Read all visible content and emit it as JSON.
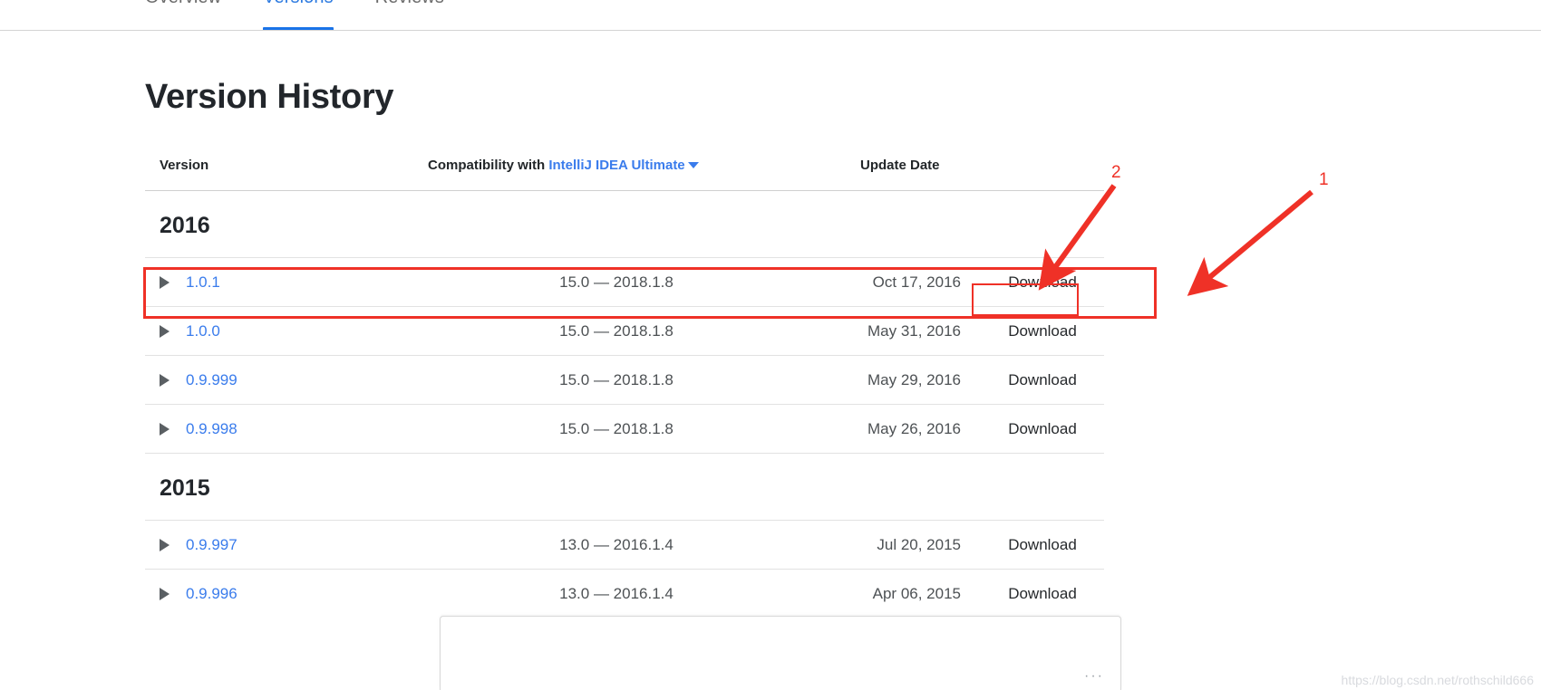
{
  "tabs": [
    {
      "label": "Overview",
      "active": false
    },
    {
      "label": "Versions",
      "active": true
    },
    {
      "label": "Reviews",
      "active": false
    }
  ],
  "page": {
    "title": "Version History"
  },
  "table": {
    "headers": {
      "version": "Version",
      "compatibility_prefix": "Compatibility with",
      "compatibility_product": "IntelliJ IDEA Ultimate",
      "update_date": "Update Date"
    },
    "groups": [
      {
        "year": "2016",
        "rows": [
          {
            "version": "1.0.1",
            "compatibility": "15.0 — 2018.1.8",
            "date": "Oct 17, 2016",
            "download": "Download",
            "highlighted": true
          },
          {
            "version": "1.0.0",
            "compatibility": "15.0 — 2018.1.8",
            "date": "May 31, 2016",
            "download": "Download",
            "highlighted": false
          },
          {
            "version": "0.9.999",
            "compatibility": "15.0 — 2018.1.8",
            "date": "May 29, 2016",
            "download": "Download",
            "highlighted": false
          },
          {
            "version": "0.9.998",
            "compatibility": "15.0 — 2018.1.8",
            "date": "May 26, 2016",
            "download": "Download",
            "highlighted": false
          }
        ]
      },
      {
        "year": "2015",
        "rows": [
          {
            "version": "0.9.997",
            "compatibility": "13.0 — 2016.1.4",
            "date": "Jul 20, 2015",
            "download": "Download",
            "highlighted": false
          },
          {
            "version": "0.9.996",
            "compatibility": "13.0 — 2016.1.4",
            "date": "Apr 06, 2015",
            "download": "Download",
            "highlighted": false
          }
        ]
      }
    ]
  },
  "annotations": {
    "marker_1": "1",
    "marker_2": "2",
    "color": "#ef3127"
  },
  "bottom_panel": {
    "dots": "···"
  },
  "watermark": {
    "text": "https://blog.csdn.net/rothschild666"
  },
  "colors": {
    "link": "#3a7cec",
    "tab_active": "#2c7ae0",
    "text": "#22262b",
    "muted": "#55595d",
    "annotation_red": "#ef3127"
  }
}
